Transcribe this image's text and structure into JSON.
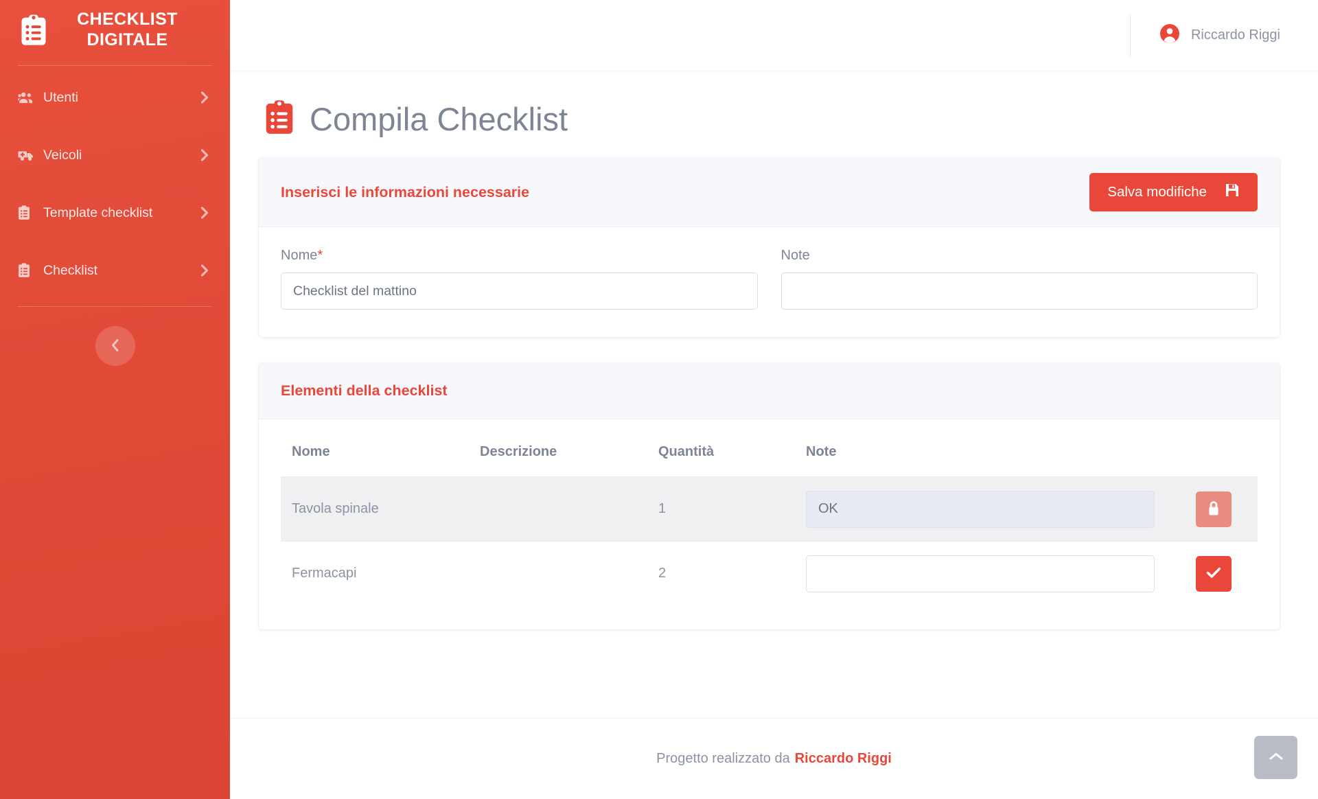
{
  "brand": {
    "title": "CHECKLIST DIGITALE",
    "icon": "clipboard-list-icon"
  },
  "sidebar": {
    "items": [
      {
        "label": "Utenti",
        "icon": "users-icon"
      },
      {
        "label": "Veicoli",
        "icon": "ambulance-icon"
      },
      {
        "label": "Template checklist",
        "icon": "clipboard-icon"
      },
      {
        "label": "Checklist",
        "icon": "clipboard-icon"
      }
    ],
    "collapse_icon": "chevron-left-icon",
    "item_chevron_icon": "chevron-right-icon"
  },
  "topbar": {
    "user_name": "Riccardo Riggi",
    "user_icon": "user-circle-icon"
  },
  "page": {
    "title": "Compila Checklist",
    "title_icon": "clipboard-list-icon"
  },
  "info_card": {
    "header_title": "Inserisci le informazioni necessarie",
    "save_label": "Salva modifiche",
    "save_icon": "save-icon",
    "fields": {
      "nome": {
        "label": "Nome",
        "required_mark": "*",
        "value": "Checklist del mattino",
        "placeholder": ""
      },
      "note": {
        "label": "Note",
        "value": "",
        "placeholder": ""
      }
    }
  },
  "elements_card": {
    "header_title": "Elementi della checklist",
    "columns": [
      "Nome",
      "Descrizione",
      "Quantità",
      "Note"
    ],
    "rows": [
      {
        "nome": "Tavola spinale",
        "descrizione": "",
        "quantita": "1",
        "note_value": "OK",
        "note_placeholder": "",
        "locked": true,
        "action_icon": "lock-icon"
      },
      {
        "nome": "Fermacapi",
        "descrizione": "",
        "quantita": "2",
        "note_value": "",
        "note_placeholder": "",
        "locked": false,
        "action_icon": "check-icon"
      }
    ]
  },
  "footer": {
    "text": "Progetto realizzato da",
    "author": "Riccardo Riggi"
  },
  "scroll_top": {
    "icon": "chevron-up-icon"
  },
  "colors": {
    "brand_red": "#E8473A",
    "sidebar_red": "#E04A37",
    "muted_text": "#8A93A3",
    "title_gray": "#7C8496",
    "card_header_bg": "#F7F8FC",
    "locked_row_bg": "#F0F0F2",
    "locked_input_bg": "#E7EAF2",
    "lock_btn": "#E98C80",
    "scroll_top_bg": "#B9BCC4"
  }
}
